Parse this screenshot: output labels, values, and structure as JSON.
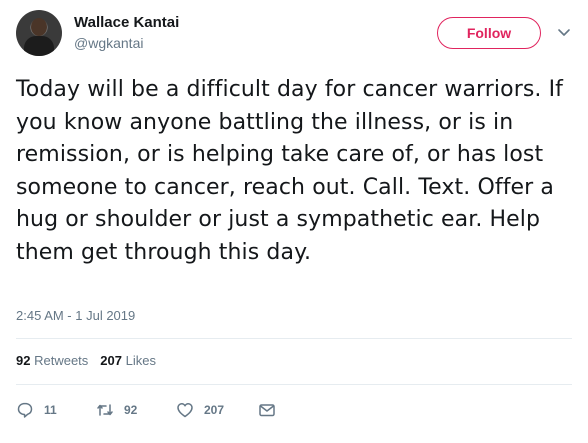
{
  "author": {
    "name": "Wallace Kantai",
    "handle": "@wgkantai"
  },
  "follow_label": "Follow",
  "tweet": {
    "text": "Today will be a difficult day for cancer warriors. If you know anyone battling the illness, or is in remission, or is helping take care of, or has lost someone to cancer, reach out. Call. Text. Offer a hug or shoulder or just a sympathetic ear. Help them get through this day.",
    "timestamp": "2:45 AM - 1 Jul 2019"
  },
  "stats": {
    "retweets_count": "92",
    "retweets_label": "Retweets",
    "likes_count": "207",
    "likes_label": "Likes"
  },
  "actions": {
    "reply_count": "11",
    "retweet_count": "92",
    "like_count": "207"
  },
  "icons": {
    "reply": "reply-icon",
    "retweet": "retweet-icon",
    "like": "heart-icon",
    "message": "envelope-icon",
    "caret": "chevron-down-icon"
  },
  "colors": {
    "follow_accent": "#e0245e",
    "secondary_text": "#657786",
    "primary_text": "#14171a"
  }
}
